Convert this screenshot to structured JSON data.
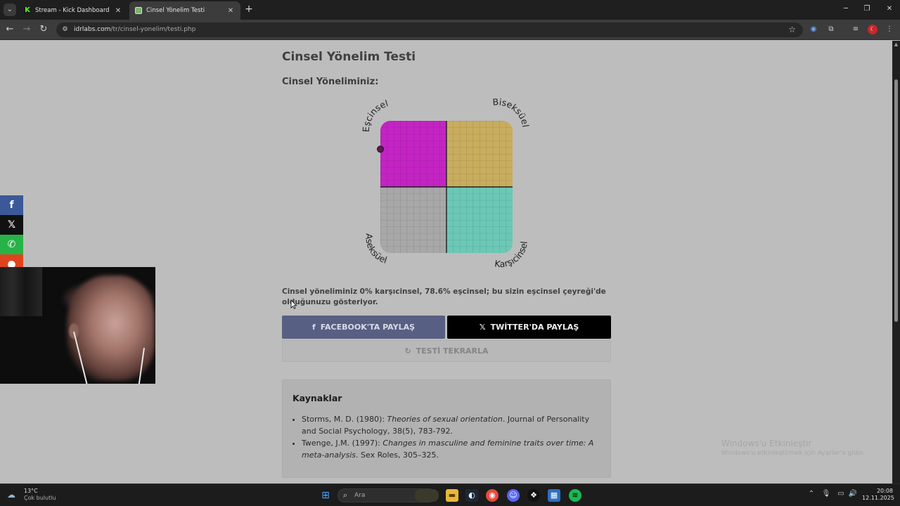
{
  "browser": {
    "tabs": [
      {
        "title": "Stream - Kick Dashboard",
        "favicon": "kick-favicon",
        "active": false
      },
      {
        "title": "Cinsel Yönelim Testi",
        "favicon": "idrlabs-favicon",
        "active": true
      }
    ],
    "url_host": "idrlabs.com",
    "url_path": "/tr/cinsel-yonelim/testi.php"
  },
  "page": {
    "title": "Cinsel Yönelim Testi",
    "subtitle": "Cinsel Yöneliminiz:",
    "chart": {
      "labels": {
        "top_left": "Eşcinsel",
        "top_right": "Biseksüel",
        "bottom_left": "Aseksüel",
        "bottom_right": "Karşıcinsel"
      },
      "quadrant_colors": {
        "top_left": "#c324c3",
        "top_right": "#c9ad5e",
        "bottom_left": "#a8a8a8",
        "bottom_right": "#6cc8b6"
      },
      "marker": {
        "heterosexual_percent": 0,
        "homosexual_percent": 78.6
      }
    },
    "result_text": "Cinsel yöneliminiz 0% karşıcinsel, 78.6% eşcinsel; bu sizin eşcinsel çeyreği'de olduğunuzu gösteriyor.",
    "buttons": {
      "facebook": "FACEBOOK'TA PAYLAŞ",
      "twitter": "TWİTTER'DA PAYLAŞ",
      "retry": "TESTİ TEKRARLA"
    },
    "sources": {
      "title": "Kaynaklar",
      "items": [
        {
          "pre": "Storms, M. D. (1980): ",
          "italic": "Theories of sexual orientation",
          "post": ". Journal of Personality and Social Psychology, 38(5), 783-792."
        },
        {
          "pre": "Twenge, J.M. (1997): ",
          "italic": "Changes in masculine and feminine traits over time: A meta-analysis",
          "post": ". Sex Roles, 305–325."
        }
      ]
    },
    "watermark": {
      "line1": "Windows'u Etkinleştir",
      "line2": "Windows'u etkinleştirmek için Ayarlar'a gidin."
    }
  },
  "share_bar": [
    "facebook-icon",
    "x-icon",
    "whatsapp-icon",
    "reddit-icon"
  ],
  "taskbar": {
    "weather_temp": "13°C",
    "weather_desc": "Çok bulutlu",
    "search_placeholder": "Ara",
    "time": "20:08",
    "date": "12.11.2025"
  },
  "colors": {
    "facebook": "#3b5998",
    "twitter": "#000000",
    "whatsapp": "#25d366",
    "reddit": "#ff4500"
  }
}
